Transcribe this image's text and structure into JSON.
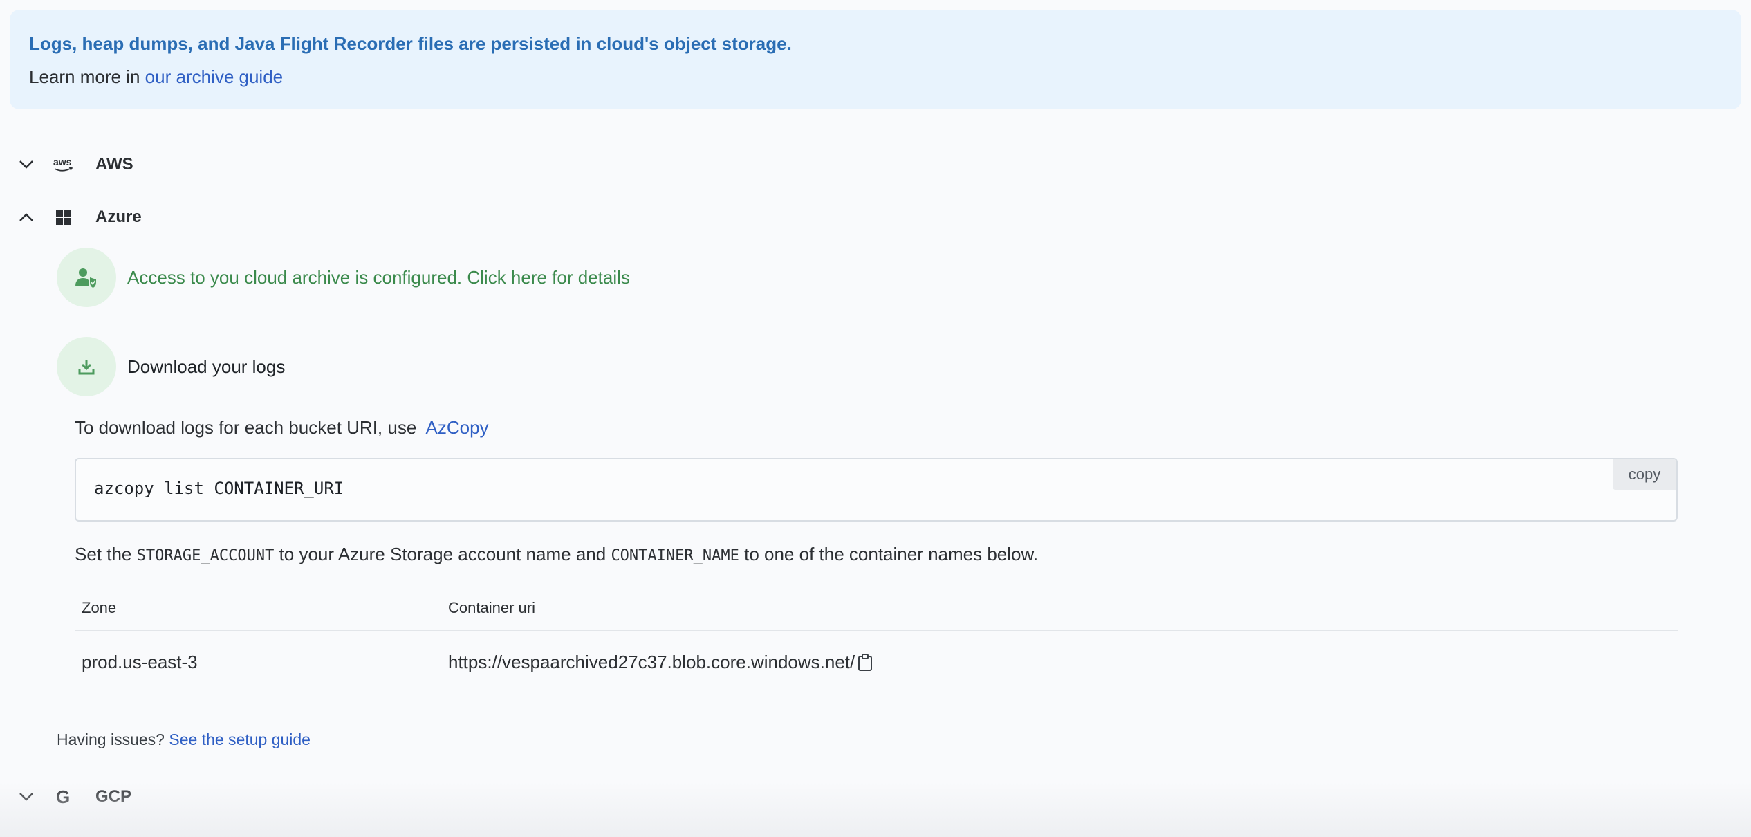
{
  "banner": {
    "title": "Logs, heap dumps, and Java Flight Recorder files are persisted in cloud's object storage.",
    "learn_prefix": "Learn more in",
    "learn_link": "our archive guide"
  },
  "providers": {
    "aws": {
      "name": "AWS",
      "expanded": false,
      "logo_text": "aws"
    },
    "azure": {
      "name": "Azure",
      "expanded": true
    },
    "gcp": {
      "name": "GCP",
      "expanded": false,
      "logo_text": "G"
    }
  },
  "azure": {
    "access_text": "Access to you cloud archive is configured. Click here for details",
    "download_title": "Download your logs",
    "instruction_prefix": "To download logs for each bucket URI, use",
    "instruction_link": "AzCopy",
    "command": "azcopy list CONTAINER_URI",
    "copy_label": "copy",
    "set_prefix": "Set the",
    "storage_account": "STORAGE_ACCOUNT",
    "set_middle": "to your Azure Storage account name and",
    "container_name": "CONTAINER_NAME",
    "set_suffix": "to one of the container names below.",
    "table": {
      "headers": [
        "Zone",
        "Container uri"
      ],
      "rows": [
        {
          "zone": "prod.us-east-3",
          "uri": "https://vespaarchived27c37.blob.core.windows.net/"
        }
      ]
    },
    "issues_prefix": "Having issues?",
    "issues_link": "See the setup guide"
  },
  "colors": {
    "banner_bg": "#e8f3fd",
    "banner_title": "#2a6db4",
    "link": "#2f5fc4",
    "success_green": "#3b8a4c",
    "success_bg": "#e3f3e6"
  },
  "icons": {
    "aws": "aws-logo-icon",
    "azure": "windows-logo-icon",
    "gcp": "google-logo-icon",
    "access": "user-shield-icon",
    "download": "download-icon",
    "clipboard": "clipboard-icon",
    "collapsed": "chevron-down-icon",
    "expanded": "chevron-up-icon"
  }
}
